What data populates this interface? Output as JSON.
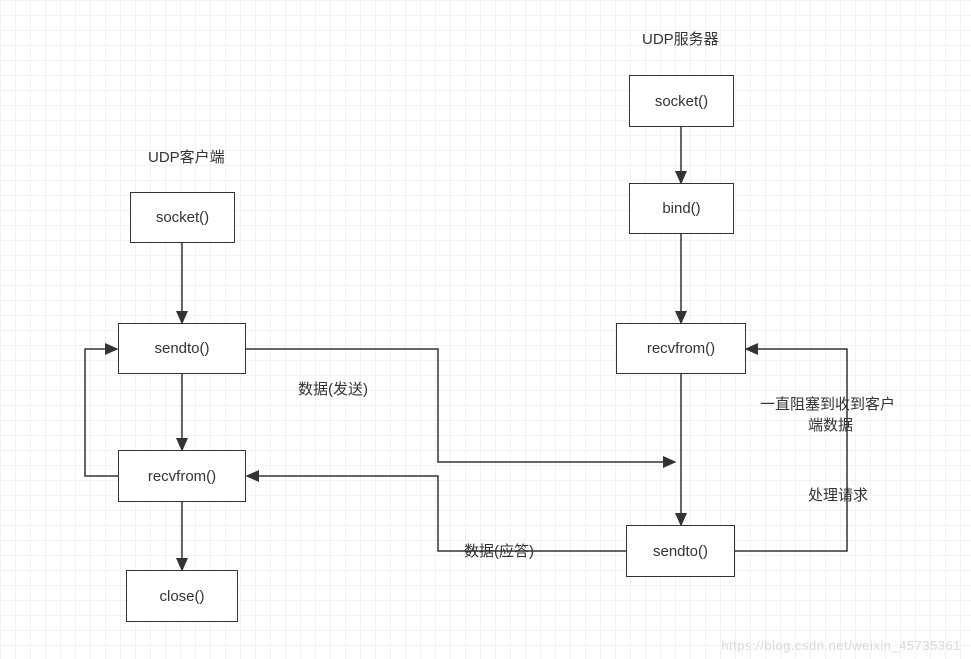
{
  "client": {
    "title": "UDP客户端",
    "socket": "socket()",
    "sendto": "sendto()",
    "recvfrom": "recvfrom()",
    "close": "close()"
  },
  "server": {
    "title": "UDP服务器",
    "socket": "socket()",
    "bind": "bind()",
    "recvfrom": "recvfrom()",
    "sendto": "sendto()"
  },
  "labels": {
    "data_send": "数据(发送)",
    "data_reply": "数据(应答)",
    "block_note1": "一直阻塞到收到客户",
    "block_note2": "端数据",
    "handle_req": "处理请求"
  },
  "watermark": "https://blog.csdn.net/weixin_45735361",
  "chart_data": {
    "type": "flowchart",
    "nodes": [
      {
        "id": "c_title",
        "text": "UDP客户端",
        "kind": "label"
      },
      {
        "id": "c_socket",
        "text": "socket()",
        "kind": "process"
      },
      {
        "id": "c_sendto",
        "text": "sendto()",
        "kind": "process"
      },
      {
        "id": "c_recvfrom",
        "text": "recvfrom()",
        "kind": "process"
      },
      {
        "id": "c_close",
        "text": "close()",
        "kind": "process"
      },
      {
        "id": "s_title",
        "text": "UDP服务器",
        "kind": "label"
      },
      {
        "id": "s_socket",
        "text": "socket()",
        "kind": "process"
      },
      {
        "id": "s_bind",
        "text": "bind()",
        "kind": "process"
      },
      {
        "id": "s_recvfrom",
        "text": "recvfrom()",
        "kind": "process"
      },
      {
        "id": "s_sendto",
        "text": "sendto()",
        "kind": "process"
      }
    ],
    "edges": [
      {
        "from": "c_socket",
        "to": "c_sendto"
      },
      {
        "from": "c_sendto",
        "to": "c_recvfrom"
      },
      {
        "from": "c_recvfrom",
        "to": "c_close"
      },
      {
        "from": "c_recvfrom",
        "to": "c_sendto",
        "note": "loop back (left side)"
      },
      {
        "from": "s_socket",
        "to": "s_bind"
      },
      {
        "from": "s_bind",
        "to": "s_recvfrom"
      },
      {
        "from": "c_sendto",
        "to": "s_recvfrom",
        "label": "数据(发送)"
      },
      {
        "from": "s_recvfrom",
        "to": "s_sendto",
        "label": "一直阻塞到收到客户端数据 / 处理请求"
      },
      {
        "from": "s_sendto",
        "to": "c_recvfrom",
        "label": "数据(应答)"
      },
      {
        "from": "s_sendto",
        "to": "s_recvfrom",
        "note": "loop back (right side)"
      }
    ]
  }
}
